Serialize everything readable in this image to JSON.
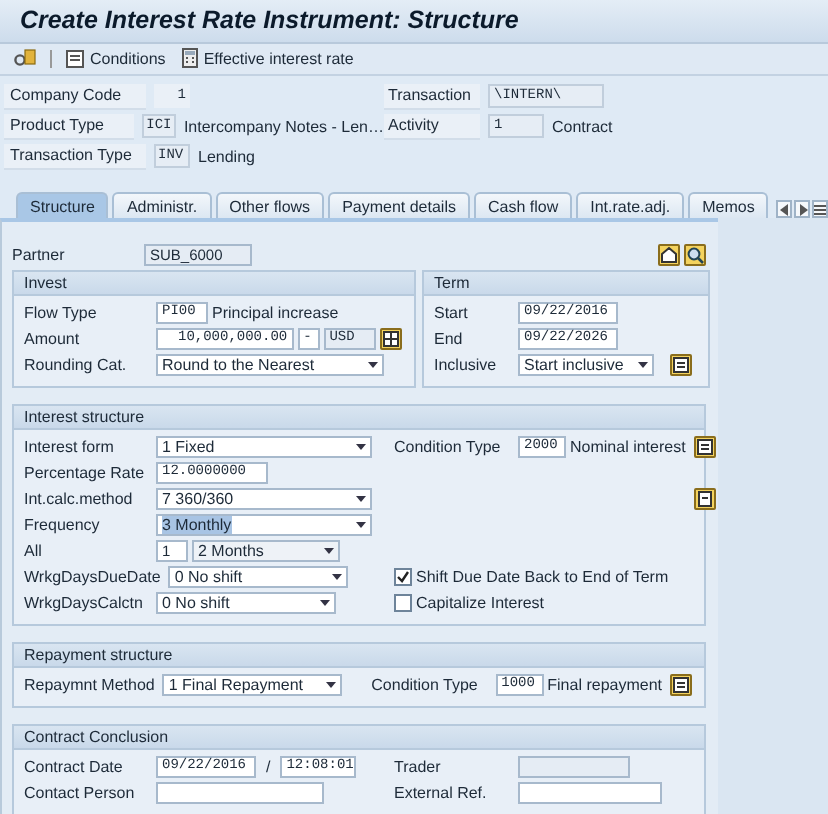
{
  "window": {
    "title": "Create Interest Rate Instrument: Structure"
  },
  "toolbar": [
    {
      "label": "Conditions"
    },
    {
      "label": "Effective interest rate"
    }
  ],
  "header_left": [
    {
      "label": "Company Code",
      "value": "1"
    },
    {
      "label": "Product Type",
      "value": "ICI",
      "text": "Intercompany Notes - Len…"
    },
    {
      "label": "Transaction Type",
      "value": "INV",
      "text": "Lending"
    }
  ],
  "header_right": [
    {
      "label": "Transaction",
      "value": "\\INTERN\\"
    },
    {
      "label": "Activity",
      "value": "1",
      "text": "Contract"
    }
  ],
  "tabs": [
    {
      "label": "Structure",
      "selected": true
    },
    {
      "label": "Administr.",
      "selected": false
    },
    {
      "label": "Other flows",
      "selected": false
    },
    {
      "label": "Payment details",
      "selected": false
    },
    {
      "label": "Cash flow",
      "selected": false
    },
    {
      "label": "Int.rate.adj.",
      "selected": false
    },
    {
      "label": "Memos",
      "selected": false
    }
  ],
  "partner": {
    "label": "Partner",
    "value": "SUB_6000"
  },
  "invest": {
    "title": "Invest",
    "flow_type": {
      "label": "Flow Type",
      "value": "PI00",
      "text": "Principal increase"
    },
    "amount": {
      "label": "Amount",
      "value": "10,000,000.00",
      "sign": "-",
      "currency": "USD"
    },
    "rounding": {
      "label": "Rounding Cat.",
      "value": "Round to the Nearest"
    }
  },
  "term": {
    "title": "Term",
    "start": {
      "label": "Start",
      "value": "09/22/2016"
    },
    "end": {
      "label": "End",
      "value": "09/22/2026"
    },
    "inclusive": {
      "label": "Inclusive",
      "value": "Start inclusive"
    }
  },
  "interest": {
    "title": "Interest structure",
    "form": {
      "label": "Interest form",
      "value": "1 Fixed"
    },
    "condition": {
      "label": "Condition Type",
      "value": "2000",
      "text": "Nominal interest"
    },
    "rate": {
      "label": "Percentage Rate",
      "value": "12.0000000"
    },
    "calc": {
      "label": "Int.calc.method",
      "value": "7 360/360"
    },
    "frequency": {
      "label": "Frequency",
      "value": "3 Monthly",
      "highlighted": true
    },
    "all": {
      "label": "All",
      "value": "1",
      "unit": "2 Months"
    },
    "due": {
      "label": "WrkgDaysDueDate",
      "value": "0 No shift"
    },
    "calctn": {
      "label": "WrkgDaysCalctn",
      "value": "0 No shift"
    },
    "checks": [
      {
        "label": "Shift Due Date Back to End of Term",
        "checked": true
      },
      {
        "label": "Capitalize Interest",
        "checked": false
      }
    ]
  },
  "repayment": {
    "title": "Repayment structure",
    "method": {
      "label": "Repaymnt Method",
      "value": "1 Final Repayment"
    },
    "condition": {
      "label": "Condition Type",
      "value": "1000",
      "text": "Final repayment"
    }
  },
  "contract": {
    "title": "Contract Conclusion",
    "date": {
      "label": "Contract Date",
      "value": "09/22/2016",
      "separator": "/",
      "time": "12:08:01"
    },
    "trader": {
      "label": "Trader"
    },
    "person": {
      "label": "Contact Person"
    },
    "external": {
      "label": "External Ref."
    }
  }
}
